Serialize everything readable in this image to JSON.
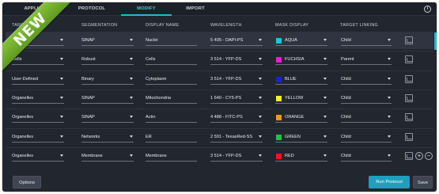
{
  "tabs": [
    {
      "label": "APPLICATION"
    },
    {
      "label": "PROTOCOL"
    },
    {
      "label": "MODIFY"
    },
    {
      "label": "IMPORT"
    }
  ],
  "ribbon": {
    "label": "NEW"
  },
  "info_icon": {
    "glyph": "i",
    "icon": "info-icon"
  },
  "columns": [
    "TARGET",
    "SEGMENTATION",
    "DISPLAY NAME",
    "WAVELENGTH",
    "MASK DISPLAY",
    "TARGET LINKING"
  ],
  "rows": [
    {
      "target": "Nuclei",
      "segmentation": "SINAP",
      "display_name": "Nuclei",
      "wavelength": "5 405 - DAPI-PS",
      "mask_color": "#19c7d6",
      "mask_label": "AQUA",
      "linking": "Child"
    },
    {
      "target": "Cells",
      "segmentation": "Robust",
      "display_name": "Cells",
      "wavelength": "3 514 - YFP-DS",
      "mask_color": "#e71ed1",
      "mask_label": "FUCHSIA",
      "linking": "Parent"
    },
    {
      "target": "User-Defined",
      "segmentation": "Binary",
      "display_name": "Cytoplasm",
      "wavelength": "3 514 - YFP-DS",
      "mask_color": "#1a22d6",
      "mask_label": "BLUE",
      "linking": "Child"
    },
    {
      "target": "Organelles",
      "segmentation": "SINAP",
      "display_name": "Mitochondria",
      "wavelength": "1 640 - CY5-PS",
      "mask_color": "#f2f21a",
      "mask_label": "YELLOW",
      "linking": "Child"
    },
    {
      "target": "Organelles",
      "segmentation": "SINAP",
      "display_name": "Actin",
      "wavelength": "4 488 - FITC-PS",
      "mask_color": "#f29a16",
      "mask_label": "ORANGE",
      "linking": "Child"
    },
    {
      "target": "Organelles",
      "segmentation": "Networks",
      "display_name": "ER",
      "wavelength": "2 591 - TexasRed-SS",
      "mask_color": "#1fc43b",
      "mask_label": "GREEN",
      "linking": "Child"
    },
    {
      "target": "Organelles",
      "segmentation": "Membrane",
      "display_name": "Membrane",
      "wavelength": "3 514 - YFP-DS",
      "mask_color": "#e41c1c",
      "mask_label": "RED",
      "linking": "Child"
    }
  ],
  "row_actions": {
    "chart_icon": "chart-icon",
    "add_icon": "+",
    "remove_icon": "−"
  },
  "buttons": {
    "options": "Options",
    "run": "Run Protocol",
    "save": "Save"
  },
  "colors": {
    "accent": "#2fb3cf",
    "background": "#22262f",
    "ribbon": "#6fae2b"
  }
}
